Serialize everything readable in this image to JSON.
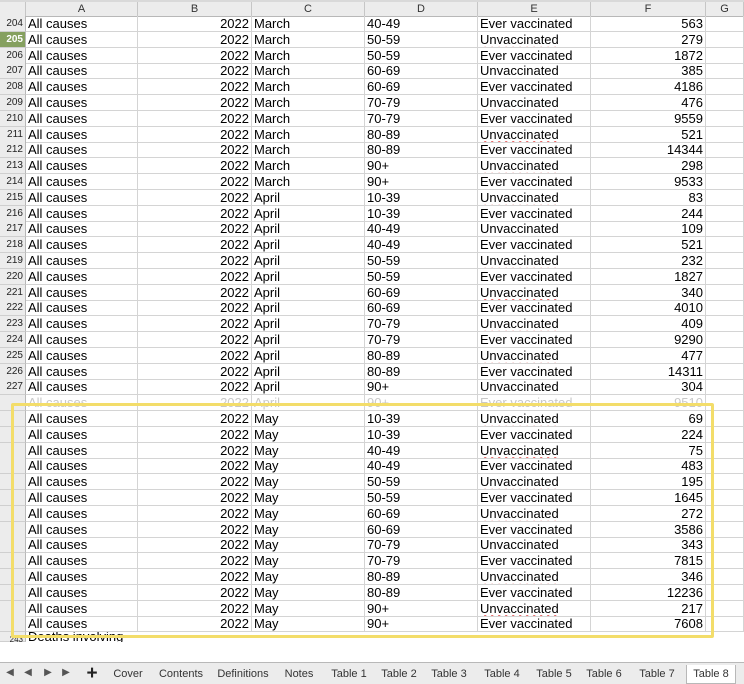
{
  "columns": [
    "A",
    "B",
    "C",
    "D",
    "E",
    "F",
    "G"
  ],
  "rows": [
    {
      "n": "204",
      "a": "All causes",
      "b": "2022",
      "c": "March",
      "d": "40-49",
      "e": "Ever vaccinated",
      "f": "563"
    },
    {
      "n": "205",
      "a": "All causes",
      "b": "2022",
      "c": "March",
      "d": "50-59",
      "e": "Unvaccinated",
      "f": "279"
    },
    {
      "n": "206",
      "a": "All causes",
      "b": "2022",
      "c": "March",
      "d": "50-59",
      "e": "Ever vaccinated",
      "f": "1872"
    },
    {
      "n": "207",
      "a": "All causes",
      "b": "2022",
      "c": "March",
      "d": "60-69",
      "e": "Unvaccinated",
      "f": "385"
    },
    {
      "n": "208",
      "a": "All causes",
      "b": "2022",
      "c": "March",
      "d": "60-69",
      "e": "Ever vaccinated",
      "f": "4186"
    },
    {
      "n": "209",
      "a": "All causes",
      "b": "2022",
      "c": "March",
      "d": "70-79",
      "e": "Unvaccinated",
      "f": "476"
    },
    {
      "n": "210",
      "a": "All causes",
      "b": "2022",
      "c": "March",
      "d": "70-79",
      "e": "Ever vaccinated",
      "f": "9559"
    },
    {
      "n": "211",
      "a": "All causes",
      "b": "2022",
      "c": "March",
      "d": "80-89",
      "e": "Unvaccinated",
      "f": "521"
    },
    {
      "n": "212",
      "a": "All causes",
      "b": "2022",
      "c": "March",
      "d": "80-89",
      "e": "Ever vaccinated",
      "f": "14344"
    },
    {
      "n": "213",
      "a": "All causes",
      "b": "2022",
      "c": "March",
      "d": "90+",
      "e": "Unvaccinated",
      "f": "298"
    },
    {
      "n": "214",
      "a": "All causes",
      "b": "2022",
      "c": "March",
      "d": "90+",
      "e": "Ever vaccinated",
      "f": "9533"
    },
    {
      "n": "215",
      "a": "All causes",
      "b": "2022",
      "c": "April",
      "d": "10-39",
      "e": "Unvaccinated",
      "f": "83"
    },
    {
      "n": "216",
      "a": "All causes",
      "b": "2022",
      "c": "April",
      "d": "10-39",
      "e": "Ever vaccinated",
      "f": "244"
    },
    {
      "n": "217",
      "a": "All causes",
      "b": "2022",
      "c": "April",
      "d": "40-49",
      "e": "Unvaccinated",
      "f": "109"
    },
    {
      "n": "218",
      "a": "All causes",
      "b": "2022",
      "c": "April",
      "d": "40-49",
      "e": "Ever vaccinated",
      "f": "521"
    },
    {
      "n": "219",
      "a": "All causes",
      "b": "2022",
      "c": "April",
      "d": "50-59",
      "e": "Unvaccinated",
      "f": "232"
    },
    {
      "n": "220",
      "a": "All causes",
      "b": "2022",
      "c": "April",
      "d": "50-59",
      "e": "Ever vaccinated",
      "f": "1827"
    },
    {
      "n": "221",
      "a": "All causes",
      "b": "2022",
      "c": "April",
      "d": "60-69",
      "e": "Unvaccinated",
      "f": "340"
    },
    {
      "n": "222",
      "a": "All causes",
      "b": "2022",
      "c": "April",
      "d": "60-69",
      "e": "Ever vaccinated",
      "f": "4010"
    },
    {
      "n": "223",
      "a": "All causes",
      "b": "2022",
      "c": "April",
      "d": "70-79",
      "e": "Unvaccinated",
      "f": "409"
    },
    {
      "n": "224",
      "a": "All causes",
      "b": "2022",
      "c": "April",
      "d": "70-79",
      "e": "Ever vaccinated",
      "f": "9290"
    },
    {
      "n": "225",
      "a": "All causes",
      "b": "2022",
      "c": "April",
      "d": "80-89",
      "e": "Unvaccinated",
      "f": "477"
    },
    {
      "n": "226",
      "a": "All causes",
      "b": "2022",
      "c": "April",
      "d": "80-89",
      "e": "Ever vaccinated",
      "f": "14311"
    },
    {
      "n": "227",
      "a": "All causes",
      "b": "2022",
      "c": "April",
      "d": "90+",
      "e": "Unvaccinated",
      "f": "304"
    },
    {
      "n": "",
      "a": "All causes",
      "b": "2022",
      "c": "April",
      "d": "90+",
      "e": "Ever vaccinated",
      "f": "9510",
      "faded": true
    },
    {
      "n": "",
      "a": "All causes",
      "b": "2022",
      "c": "May",
      "d": "10-39",
      "e": "Unvaccinated",
      "f": "69"
    },
    {
      "n": "",
      "a": "All causes",
      "b": "2022",
      "c": "May",
      "d": "10-39",
      "e": "Ever vaccinated",
      "f": "224"
    },
    {
      "n": "",
      "a": "All causes",
      "b": "2022",
      "c": "May",
      "d": "40-49",
      "e": "Unvaccinated",
      "f": "75"
    },
    {
      "n": "",
      "a": "All causes",
      "b": "2022",
      "c": "May",
      "d": "40-49",
      "e": "Ever vaccinated",
      "f": "483"
    },
    {
      "n": "",
      "a": "All causes",
      "b": "2022",
      "c": "May",
      "d": "50-59",
      "e": "Unvaccinated",
      "f": "195"
    },
    {
      "n": "",
      "a": "All causes",
      "b": "2022",
      "c": "May",
      "d": "50-59",
      "e": "Ever vaccinated",
      "f": "1645"
    },
    {
      "n": "",
      "a": "All causes",
      "b": "2022",
      "c": "May",
      "d": "60-69",
      "e": "Unvaccinated",
      "f": "272"
    },
    {
      "n": "",
      "a": "All causes",
      "b": "2022",
      "c": "May",
      "d": "60-69",
      "e": "Ever vaccinated",
      "f": "3586"
    },
    {
      "n": "",
      "a": "All causes",
      "b": "2022",
      "c": "May",
      "d": "70-79",
      "e": "Unvaccinated",
      "f": "343"
    },
    {
      "n": "",
      "a": "All causes",
      "b": "2022",
      "c": "May",
      "d": "70-79",
      "e": "Ever vaccinated",
      "f": "7815"
    },
    {
      "n": "",
      "a": "All causes",
      "b": "2022",
      "c": "May",
      "d": "80-89",
      "e": "Unvaccinated",
      "f": "346"
    },
    {
      "n": "",
      "a": "All causes",
      "b": "2022",
      "c": "May",
      "d": "80-89",
      "e": "Ever vaccinated",
      "f": "12236"
    },
    {
      "n": "",
      "a": "All causes",
      "b": "2022",
      "c": "May",
      "d": "90+",
      "e": "Unvaccinated",
      "f": "217"
    },
    {
      "n": "",
      "a": "All causes",
      "b": "2022",
      "c": "May",
      "d": "90+",
      "e": "Ever vaccinated",
      "f": "7608"
    }
  ],
  "partial_row": {
    "n": "243",
    "a": "Deaths involving"
  },
  "selected_row": "205",
  "sheet_tabs": [
    "Cover",
    "Contents",
    "Definitions",
    "Notes",
    "Table 1",
    "Table 2",
    "Table 3",
    "Table 4",
    "Table 5",
    "Table 6",
    "Table 7",
    "Table 8"
  ],
  "active_tab": "Table 8",
  "icons": {
    "nav": [
      "first-sheet-icon",
      "prev-sheet-icon",
      "next-sheet-icon",
      "last-sheet-icon"
    ],
    "add": "add-sheet-icon"
  },
  "colors": {
    "highlight": "#f3dd6a",
    "selected_row_header": "#85a05f",
    "spellcheck": "#dd2222"
  }
}
